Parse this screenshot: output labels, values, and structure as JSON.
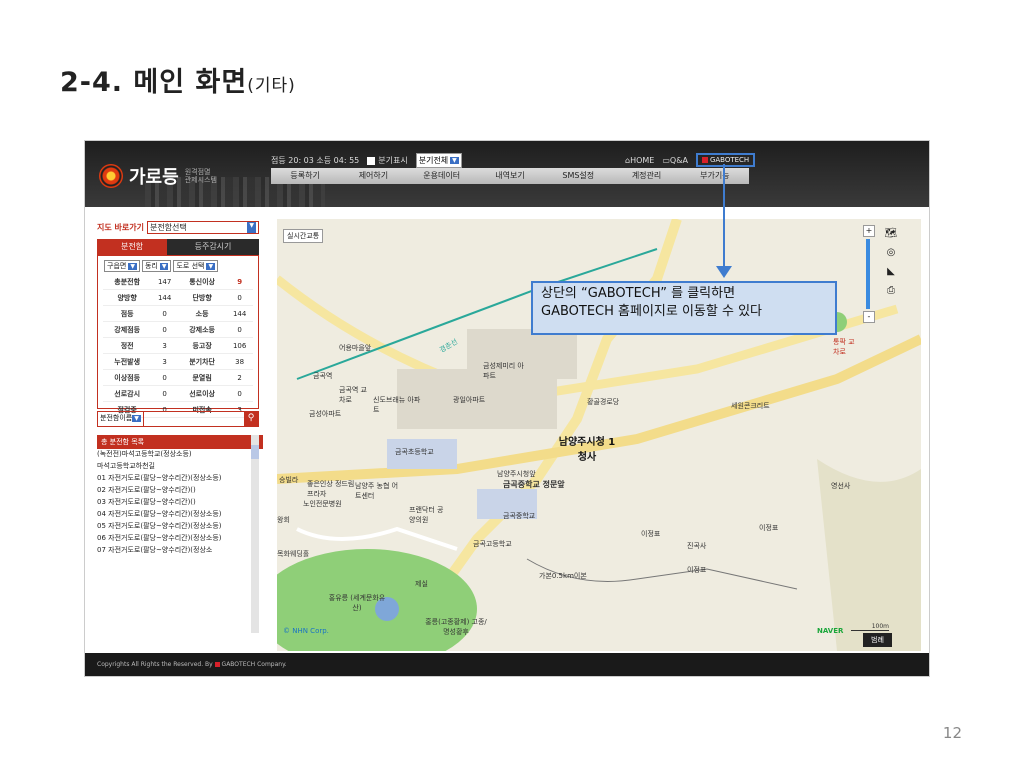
{
  "slide": {
    "title": "2-4. 메인 화면",
    "title_suffix": "(기타)",
    "page_number": "12"
  },
  "header": {
    "logo_text": "가로등",
    "logo_sub": "원격점멸 관제시스템",
    "status_time": "점등 20: 03 소등 04: 55",
    "branch_display_label": "분기표시",
    "branch_select": "분기전체",
    "home": "HOME",
    "qa": "Q&A",
    "gabotech": "GABOTECH"
  },
  "nav": [
    "등록하기",
    "제어하기",
    "운용데이터",
    "내역보기",
    "SMS설정",
    "계정관리",
    "부가기능"
  ],
  "left": {
    "shortcut_label": "지도 바로가기",
    "shortcut_select": "분전함선택",
    "tab_active": "분전함",
    "tab_inactive": "등주감시기",
    "filters": [
      "구읍면",
      "동리",
      "도로 선택"
    ],
    "stats": [
      [
        "총분전함",
        "147",
        "통신이상",
        "9"
      ],
      [
        "양방향",
        "144",
        "단방향",
        "0"
      ],
      [
        "점등",
        "0",
        "소등",
        "144"
      ],
      [
        "강제점등",
        "0",
        "강제소등",
        "0"
      ],
      [
        "정전",
        "3",
        "등고장",
        "106"
      ],
      [
        "누전발생",
        "3",
        "분기차단",
        "38"
      ],
      [
        "이상점등",
        "0",
        "문열림",
        "2"
      ],
      [
        "선로감시",
        "0",
        "선로이상",
        "0"
      ],
      [
        "점검중",
        "0",
        "미접속",
        "3"
      ]
    ],
    "search_type": "분전함이름",
    "list_title": "총 분전함 목록",
    "list_items": [
      "(녹전전)마석고등학교(정상소등)",
      "마석고등학교하천길",
      "01 자전거도로(팔당~양수리간)(정상소등)",
      "02 자전거도로(팔당~양수리간)()",
      "03 자전거도로(팔당~양수리간)()",
      "04 자전거도로(팔당~양수리간)(정상소등)",
      "05 자전거도로(팔당~양수리간)(정상소등)",
      "06 자전거도로(팔당~양수리간)(정상소등)",
      "07 자전거도로(팔당~양수리간)(정상소"
    ]
  },
  "map": {
    "realtime_btn": "실시간교통",
    "labels": {
      "l1": "어용마을앞",
      "l2": "금곡역",
      "l3": "금곡역 교차로",
      "l4": "신도브래뉴 아파트",
      "l5": "금성아파트",
      "l6": "금성제미리 아파트",
      "l7": "광일아파트",
      "l8": "황골경로당",
      "l9": "세원콘크리트",
      "l10": "통팍 교차로",
      "l11": "남양주시청 1청사",
      "l12": "금곡초등학교",
      "l13": "남양주시청앞",
      "l14": "금곡중학교 정문앞",
      "l15": "승빌라",
      "l16": "좋은인상 정드림 프라자",
      "l17": "남양주 농협 어트센터",
      "l18": "노인전문병원",
      "l19": "프랜닥터 공양의원",
      "l20": "금곡중학교",
      "l21": "금곡고등학교",
      "l22": "영선사",
      "l23": "이정표",
      "l24": "진곡사",
      "l25": "이정표",
      "l26": "이정표",
      "l27": "목화웨딩홀",
      "l28": "홍유릉 (세계문화유산)",
      "l29": "홍릉(고종황제) 고종/명성황후",
      "l30": "왕회",
      "l31": "제실",
      "l32": "가본0.5km이본"
    },
    "road_label": "경춘선",
    "callout_line1": "상단의 “GABOTECH” 를 클릭하면",
    "callout_line2": "GABOTECH 홈페이지로 이동할 수 있다",
    "nhn": "© NHN Corp.",
    "naver": "NAVER",
    "scale": "100m",
    "legend_btn": "범례",
    "zoom_in": "+",
    "zoom_out": "-"
  },
  "footer": {
    "text_prefix": "Copyrights All Rights the Reserved. By",
    "text_suffix": "GABOTECH Company."
  }
}
